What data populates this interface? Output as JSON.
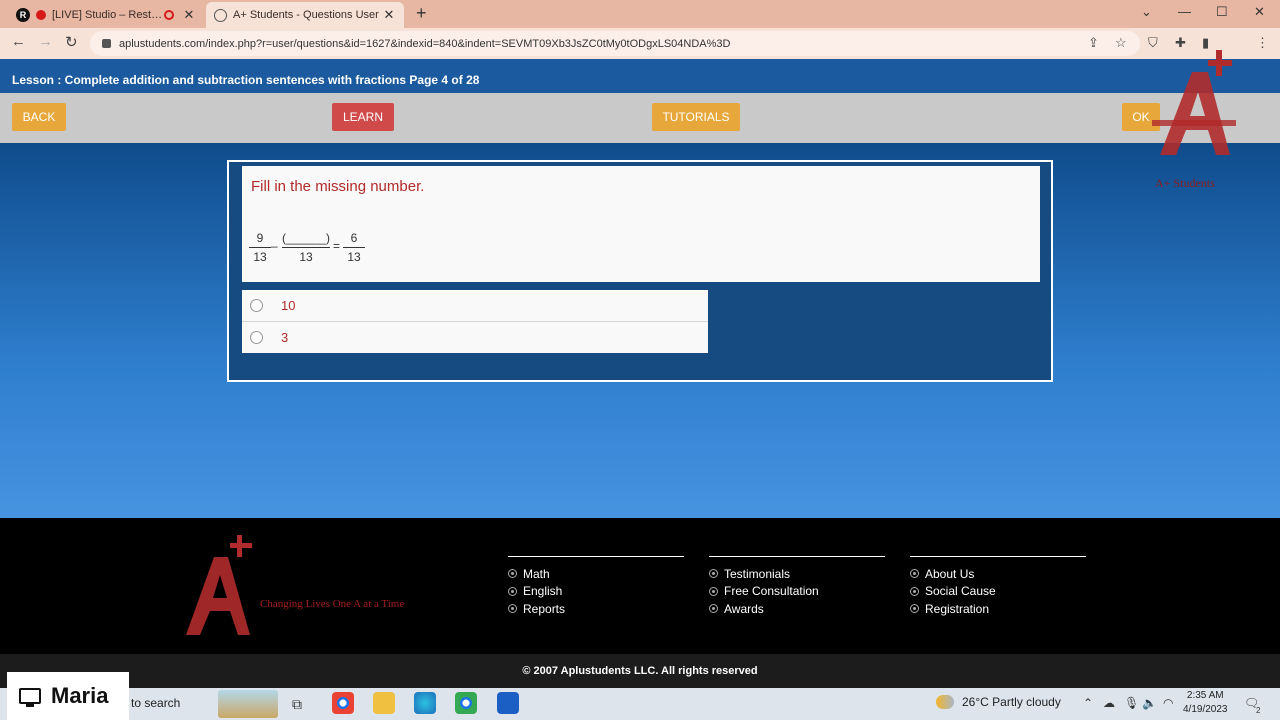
{
  "browser": {
    "tabs": [
      {
        "title": "[LIVE] Studio – Restream",
        "close": "✕"
      },
      {
        "title": "A+ Students - Questions User",
        "close": "✕"
      }
    ],
    "new_tab": "+",
    "url": "aplustudents.com/index.php?r=user/questions&id=1627&indexid=840&indent=SEVMT09Xb3JsZC0tMy0tODgxLS04NDA%3D",
    "window_controls": {
      "minimize": "—",
      "maximize": "☐",
      "close": "✕",
      "tab_search": "⌄"
    }
  },
  "lesson": {
    "title": "Lesson : Complete addition and subtraction sentences with fractions Page 4 of 28"
  },
  "nav": {
    "back": "BACK",
    "learn": "LEARN",
    "tutorials": "TUTORIALS",
    "ok": "OK"
  },
  "brand": {
    "name": "A+ Students"
  },
  "question": {
    "prompt": "Fill in the missing number.",
    "frac1": {
      "num": "9",
      "den": "13"
    },
    "minus": "–",
    "blank": {
      "num": "(______)",
      "den": "13"
    },
    "equals": "=",
    "frac2": {
      "num": "6",
      "den": "13"
    },
    "options": [
      "10",
      "3"
    ]
  },
  "footer": {
    "slogan": "Changing Lives One A at a Time",
    "col1": [
      "Math",
      "English",
      "Reports"
    ],
    "col2": [
      "Testimonials",
      "Free Consultation",
      "Awards"
    ],
    "col3": [
      "About Us",
      "Social Cause",
      "Registration"
    ],
    "copyright": "© 2007 Aplustudents LLC. All rights reserved"
  },
  "overlay": {
    "name": "Maria"
  },
  "taskbar": {
    "search": "to search",
    "weather": "26°C  Partly cloudy",
    "time": "2:35 AM",
    "date": "4/19/2023",
    "notifications": "2"
  },
  "colors": {
    "accent": "#e8a73a",
    "learn": "#d14a4a",
    "header": "#1b5a9e",
    "question_text": "#b22a2a"
  }
}
